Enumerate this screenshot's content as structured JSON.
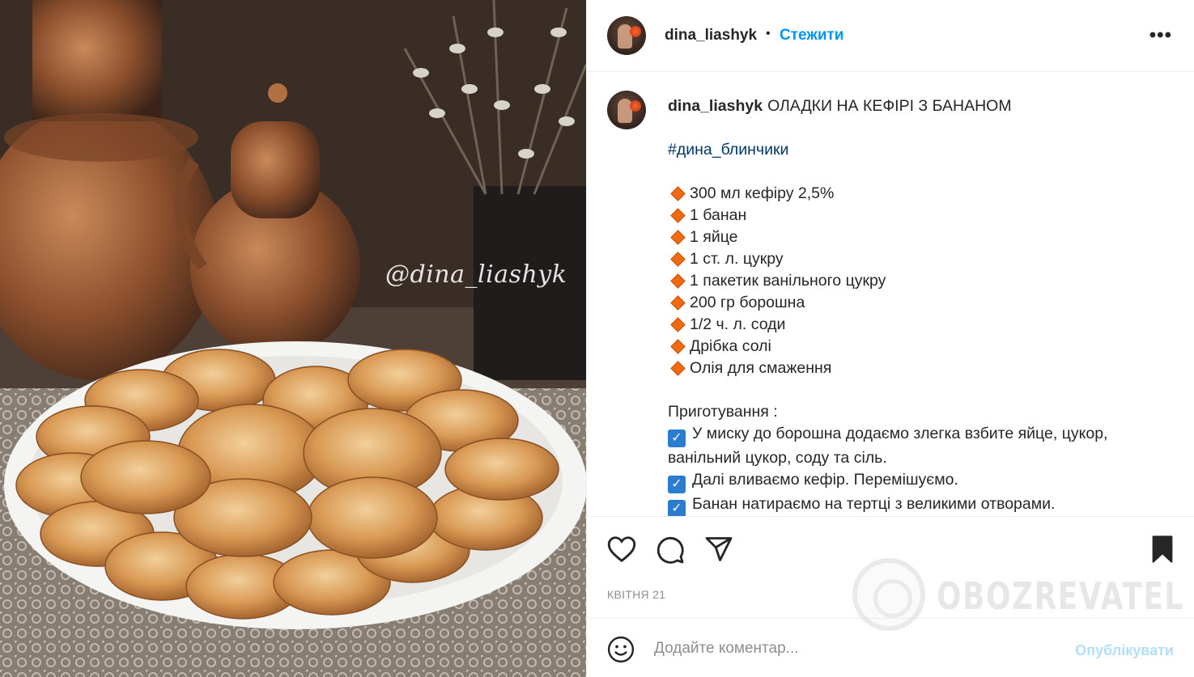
{
  "photo": {
    "watermark": "@dina_liashyk"
  },
  "header": {
    "username": "dina_liashyk",
    "separator": "•",
    "follow_label": "Стежити",
    "more_label": "•••"
  },
  "caption": {
    "username": "dina_liashyk",
    "title": "ОЛАДКИ НА КЕФІРІ З БАНАНОМ",
    "hashtag": "#дина_блинчики",
    "ingredients": [
      "300 мл кефіру 2,5%",
      "1 банан",
      "1 яйце",
      "1 ст. л. цукру",
      "1 пакетик ванільного цукру",
      "200 гр борошна",
      "1/2 ч. л. соди",
      "Дрібка солі",
      "Олія для смаження"
    ],
    "steps_heading": "Приготування :",
    "steps": [
      "У миску до борошна додаємо злегка взбите яйце, цукор, ванільний цукор, соду та сіль.",
      "Далі вливаємо кефір. Перемішуємо.",
      "Банан натираємо на тертці з великими отворами."
    ]
  },
  "actions": {
    "date": "КВІТНЯ 21"
  },
  "comment": {
    "placeholder": "Додайте коментар...",
    "publish_label": "Опублікувати"
  },
  "watermark": {
    "brand": "OBOZREVATEL"
  },
  "colors": {
    "accent": "#0095f6",
    "publish_disabled": "#b2dffc",
    "hashtag": "#00376b",
    "diamond": "#f26a0f",
    "check": "#2b7bd1"
  }
}
